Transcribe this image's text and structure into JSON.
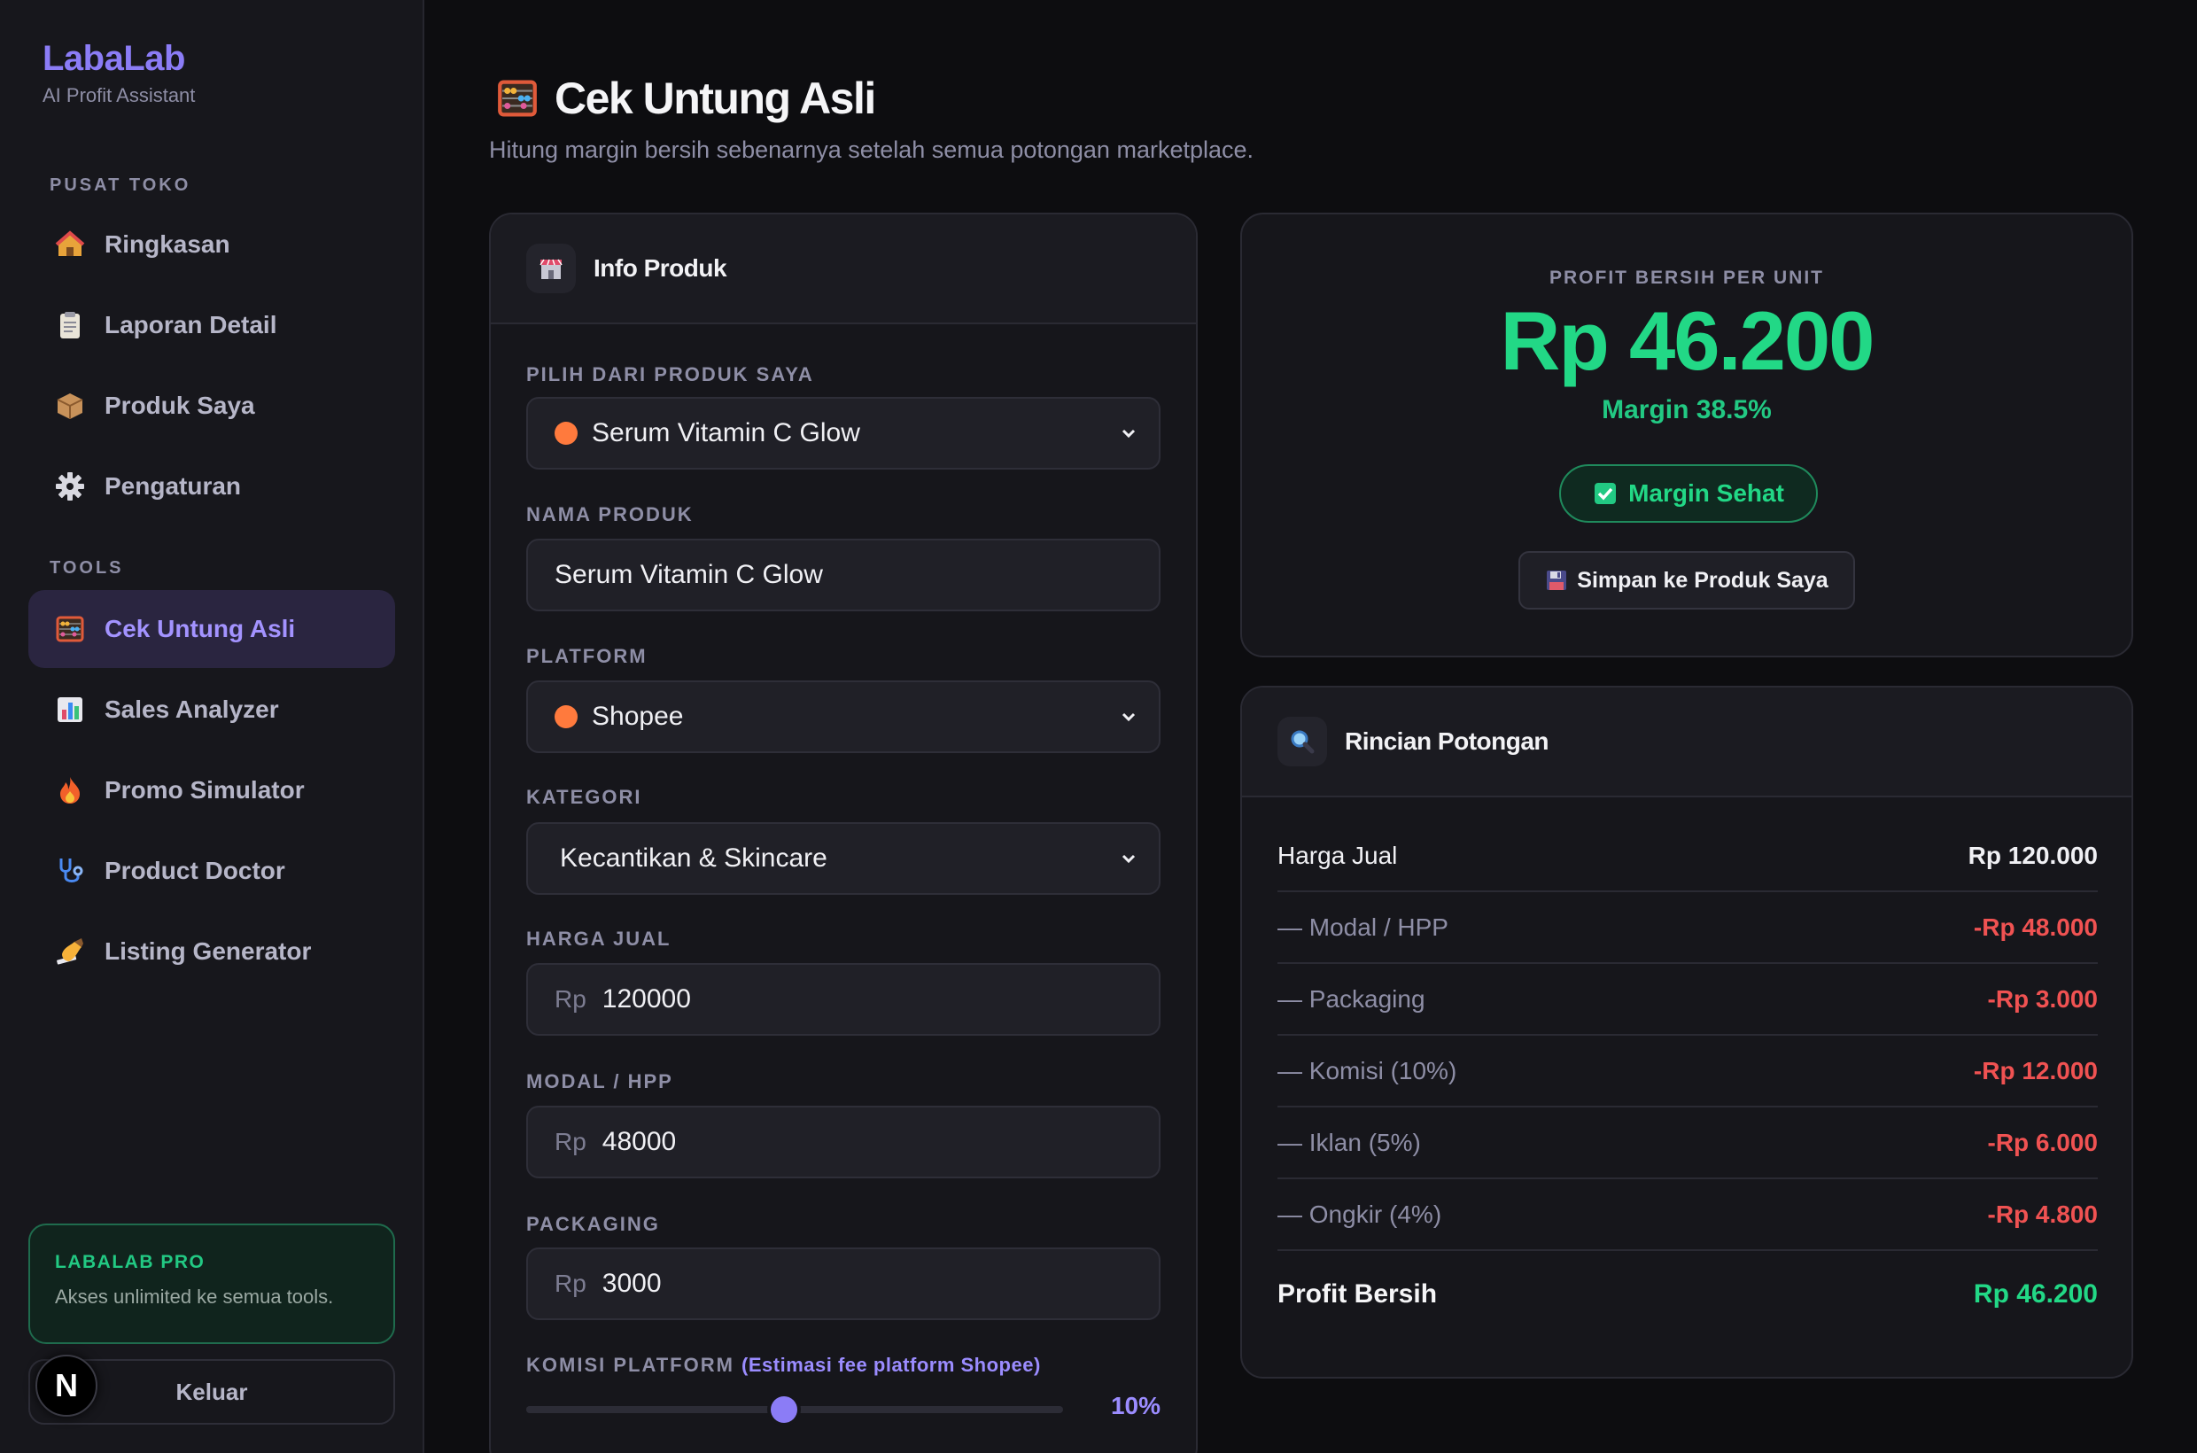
{
  "app": {
    "brand": "LabaLab",
    "tagline": "AI Profit Assistant"
  },
  "sidebar": {
    "section_store": "PUSAT TOKO",
    "section_tools": "TOOLS",
    "store_items": [
      {
        "label": "Ringkasan",
        "icon": "house-icon"
      },
      {
        "label": "Laporan Detail",
        "icon": "clipboard-icon"
      },
      {
        "label": "Produk Saya",
        "icon": "package-icon"
      },
      {
        "label": "Pengaturan",
        "icon": "gear-icon"
      }
    ],
    "tool_items": [
      {
        "label": "Cek Untung Asli",
        "icon": "abacus-icon",
        "active": true
      },
      {
        "label": "Sales Analyzer",
        "icon": "bar-chart-icon"
      },
      {
        "label": "Promo Simulator",
        "icon": "fire-icon"
      },
      {
        "label": "Product Doctor",
        "icon": "stethoscope-icon"
      },
      {
        "label": "Listing Generator",
        "icon": "writing-hand-icon"
      }
    ],
    "pro": {
      "title": "LABALAB PRO",
      "subtitle": "Akses unlimited ke semua tools."
    },
    "logout_label": "Keluar",
    "avatar_letter": "N"
  },
  "header": {
    "title": "Cek Untung Asli",
    "subtitle": "Hitung margin bersih sebenarnya setelah semua potongan marketplace."
  },
  "form": {
    "title": "Info Produk",
    "product_select_label": "PILIH DARI PRODUK SAYA",
    "product_select_value": "Serum Vitamin C Glow",
    "name_label": "NAMA PRODUK",
    "name_value": "Serum Vitamin C Glow",
    "platform_label": "PLATFORM",
    "platform_value": "Shopee",
    "category_label": "KATEGORI",
    "category_value": "Kecantikan & Skincare",
    "price_label": "HARGA JUAL",
    "price_prefix": "Rp",
    "price_value": "120000",
    "cost_label": "MODAL / HPP",
    "cost_prefix": "Rp",
    "cost_value": "48000",
    "packaging_label": "PACKAGING",
    "packaging_prefix": "Rp",
    "packaging_value": "3000",
    "commission_label": "KOMISI PLATFORM",
    "commission_note": "(Estimasi fee platform Shopee)",
    "commission_value_text": "10%",
    "commission_fraction": 0.48,
    "colors": {
      "accent": "#8b7cf6",
      "shopee_dot": "#ff7a3d"
    }
  },
  "result": {
    "label": "PROFIT BERSIH PER UNIT",
    "value": "Rp 46.200",
    "margin": "Margin 38.5%",
    "badge": "Margin Sehat",
    "save_label": "Simpan ke Produk Saya",
    "colors": {
      "profit": "#22d886",
      "deduction": "#f05252"
    }
  },
  "breakdown": {
    "title": "Rincian Potongan",
    "rows": [
      {
        "label": "Harga Jual",
        "amount": "Rp 120.000"
      },
      {
        "label": "— Modal / HPP",
        "amount": "-Rp 48.000"
      },
      {
        "label": "— Packaging",
        "amount": "-Rp 3.000"
      },
      {
        "label": "— Komisi (10%)",
        "amount": "-Rp 12.000"
      },
      {
        "label": "— Iklan (5%)",
        "amount": "-Rp 6.000"
      },
      {
        "label": "— Ongkir (4%)",
        "amount": "-Rp 4.800"
      },
      {
        "label": "Profit Bersih",
        "amount": "Rp 46.200"
      }
    ]
  }
}
